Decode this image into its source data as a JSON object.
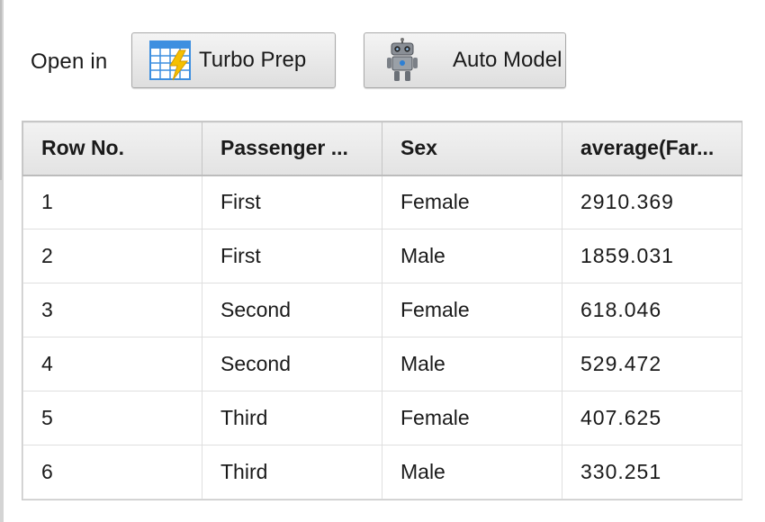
{
  "toolbar": {
    "open_in_label": "Open in",
    "turbo_prep_label": "Turbo Prep",
    "turbo_prep_icon": "spreadsheet-lightning-icon",
    "auto_model_label": "Auto Model",
    "auto_model_icon": "robot-icon"
  },
  "table": {
    "columns": [
      "Row No.",
      "Passenger ...",
      "Sex",
      "average(Far..."
    ],
    "rows": [
      [
        "1",
        "First",
        "Female",
        "2910.369"
      ],
      [
        "2",
        "First",
        "Male",
        "1859.031"
      ],
      [
        "3",
        "Second",
        "Female",
        "618.046"
      ],
      [
        "4",
        "Second",
        "Male",
        "529.472"
      ],
      [
        "5",
        "Third",
        "Female",
        "407.625"
      ],
      [
        "6",
        "Third",
        "Male",
        "330.251"
      ]
    ]
  },
  "colors": {
    "header_bg": "#e8e8e8",
    "grid_line": "#dedede",
    "button_bg": "#e6e6e6",
    "icon_blue": "#3d8fe0",
    "icon_yellow": "#f5c000"
  }
}
